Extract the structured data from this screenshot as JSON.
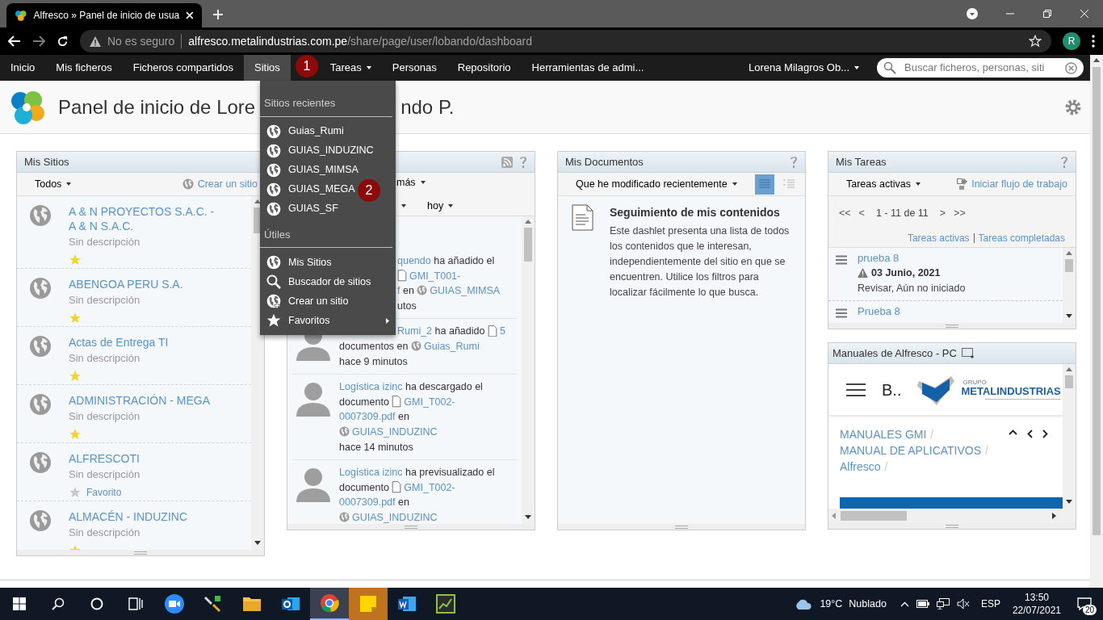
{
  "browser": {
    "tab_title": "Alfresco » Panel de inicio de usua",
    "security": "No es seguro",
    "url_host": "alfresco.metalindustrias.com.pe",
    "url_path": "/share/page/user/lobando/dashboard",
    "profile_initial": "R"
  },
  "nav": {
    "items": [
      {
        "label": "Inicio",
        "selected": false,
        "caret": false
      },
      {
        "label": "Mis ficheros",
        "selected": false,
        "caret": false
      },
      {
        "label": "Ficheros compartidos",
        "selected": false,
        "caret": false
      },
      {
        "label": "Sitios",
        "selected": true,
        "caret": false
      },
      {
        "label": "Tareas",
        "selected": false,
        "caret": true
      },
      {
        "label": "Personas",
        "selected": false,
        "caret": false
      },
      {
        "label": "Repositorio",
        "selected": false,
        "caret": false
      },
      {
        "label": "Herramientas de admi...",
        "selected": false,
        "caret": false
      }
    ],
    "user": "Lorena Milagros Ob...",
    "search_placeholder": "Buscar ficheros, personas, siti"
  },
  "callouts": [
    "1",
    "2"
  ],
  "header": {
    "title_start": "Panel de inicio de Lore",
    "title_end": "ndo P."
  },
  "sites_menu": {
    "sections": [
      {
        "heading": "Sitios recientes",
        "items": [
          {
            "label": "Guias_Rumi",
            "submenu": false
          },
          {
            "label": "GUIAS_INDUZINC",
            "submenu": false
          },
          {
            "label": "GUIAS_MIMSA",
            "submenu": false
          },
          {
            "label": "GUIAS_MEGA",
            "submenu": false
          },
          {
            "label": "GUIAS_SF",
            "submenu": false
          }
        ]
      },
      {
        "heading": "Útiles",
        "items": [
          {
            "label": "Mis Sitios",
            "submenu": false
          },
          {
            "label": "Buscador de sitios",
            "submenu": false
          },
          {
            "label": "Crear un sitio",
            "submenu": false
          },
          {
            "label": "Favoritos",
            "submenu": true
          }
        ]
      }
    ]
  },
  "my_sites": {
    "title": "Mis Sitios",
    "filter": "Todos",
    "create": "Crear un sitio",
    "sites": [
      {
        "name": "A & N PROYECTOS S.A.C. - A & N S.A.C.",
        "description": "Sin descripción",
        "favorite": true
      },
      {
        "name": "ABENGOA PERU S.A.",
        "description": "Sin descripción",
        "favorite": true
      },
      {
        "name": "Actas de Entrega TI",
        "description": "Sin descripción",
        "favorite": true
      },
      {
        "name": "ADMINISTRACIÓN - MEGA",
        "description": "Sin descripción",
        "favorite": true
      },
      {
        "name": "ALFRESCOTI",
        "description": "Sin descripción",
        "favorite": false,
        "favorite_label": "Favorito"
      },
      {
        "name": "ALMACÉN - INDUZINC",
        "description": "Sin descripción",
        "favorite": true
      }
    ]
  },
  "activities": {
    "filter_1": "más",
    "filter_3": "hoy",
    "items": [
      {
        "lines": [
          [
            {
              "text": "quendo",
              "kind": "link"
            },
            {
              "text": " ha añadido el",
              "kind": "text"
            }
          ],
          [
            {
              "text": "GMI_T001-",
              "kind": "doc-link"
            }
          ],
          [
            {
              "text": "f",
              "kind": "link"
            },
            {
              "text": " en ",
              "kind": "text"
            },
            {
              "text": "GUIAS_MIMSA",
              "kind": "site-link"
            }
          ],
          [
            {
              "text": "utos",
              "kind": "text"
            }
          ]
        ]
      },
      {
        "lines": [
          [
            {
              "text": "Rumi_2",
              "kind": "link"
            },
            {
              "text": " ha añadido ",
              "kind": "text"
            },
            {
              "text": "5",
              "kind": "doc-link"
            }
          ],
          [
            {
              "text": "documentos en ",
              "kind": "text"
            },
            {
              "text": "Guias_Rumi",
              "kind": "site-link"
            }
          ],
          [
            {
              "text": "hace 9 minutos",
              "kind": "text"
            }
          ]
        ]
      },
      {
        "lines": [
          [
            {
              "text": "Logística izinc",
              "kind": "link"
            },
            {
              "text": " ha descargado el",
              "kind": "text"
            }
          ],
          [
            {
              "text": "documento ",
              "kind": "text"
            },
            {
              "text": "GMI_T002-",
              "kind": "doc-link"
            }
          ],
          [
            {
              "text": "0007309.pdf",
              "kind": "link"
            },
            {
              "text": " en",
              "kind": "text"
            }
          ],
          [
            {
              "text": "GUIAS_INDUZINC",
              "kind": "site-link"
            }
          ],
          [
            {
              "text": "hace 14 minutos",
              "kind": "text"
            }
          ]
        ]
      },
      {
        "lines": [
          [
            {
              "text": "Logística izinc",
              "kind": "link"
            },
            {
              "text": " ha previsualizado el",
              "kind": "text"
            }
          ],
          [
            {
              "text": "documento ",
              "kind": "text"
            },
            {
              "text": "GMI_T002-",
              "kind": "doc-link"
            }
          ],
          [
            {
              "text": "0007309.pdf",
              "kind": "link"
            },
            {
              "text": " en",
              "kind": "text"
            }
          ],
          [
            {
              "text": "GUIAS_INDUZINC",
              "kind": "site-link"
            }
          ]
        ]
      }
    ]
  },
  "my_documents": {
    "title": "Mis Documentos",
    "filter": "Que he modificado recientemente",
    "views": [
      {
        "kind": "detailed",
        "selected": true
      },
      {
        "kind": "simple",
        "selected": false
      }
    ],
    "empty_title": "Seguimiento de mis contenidos",
    "empty_text": "Este dashlet presenta una lista de todos los contenidos que le interesan, independientemente del sitio en que se encuentren. Utilice los filtros para localizar fácilmente lo que busca."
  },
  "my_tasks": {
    "title": "Mis Tareas",
    "filter": "Tareas activas",
    "start_workflow": "Iniciar flujo de trabajo",
    "pager": [
      "<<",
      "<",
      "1 - 11 de 11",
      ">",
      ">>"
    ],
    "links": [
      "Tareas activas",
      "Tareas completadas"
    ],
    "tasks": [
      {
        "name": "prueba 8",
        "due": "03 Junio, 2021",
        "status": "Revisar, Aún no iniciado"
      },
      {
        "name": "Prueba 8"
      }
    ]
  },
  "manuals": {
    "title": "Manuales de Alfresco - PC",
    "site_title": "B..",
    "logo_top": "GRUPO",
    "logo_name": "METALINDUSTRIAS",
    "breadcrumbs": [
      {
        "label": "MANUALES GMI",
        "separator": "/"
      },
      {
        "label": "MANUAL DE APLICATIVOS",
        "separator": "/"
      },
      {
        "label": "Alfresco",
        "separator": "/"
      }
    ]
  },
  "taskbar": {
    "apps": [
      {
        "kind": "zoom",
        "active": false,
        "flashing": false
      },
      {
        "kind": "tools",
        "active": false,
        "flashing": false
      },
      {
        "kind": "explorer",
        "active": false,
        "flashing": false
      },
      {
        "kind": "outlook",
        "active": false,
        "flashing": false
      },
      {
        "kind": "chrome",
        "active": true,
        "flashing": false
      },
      {
        "kind": "notes",
        "active": false,
        "flashing": true
      },
      {
        "kind": "word",
        "active": false,
        "flashing": false
      },
      {
        "kind": "green",
        "active": false,
        "flashing": false
      }
    ],
    "weather": "19°C",
    "weather_text": "Nublado",
    "language": "ESP",
    "time": "13:50",
    "date": "22/07/2021",
    "notifications": "20"
  }
}
